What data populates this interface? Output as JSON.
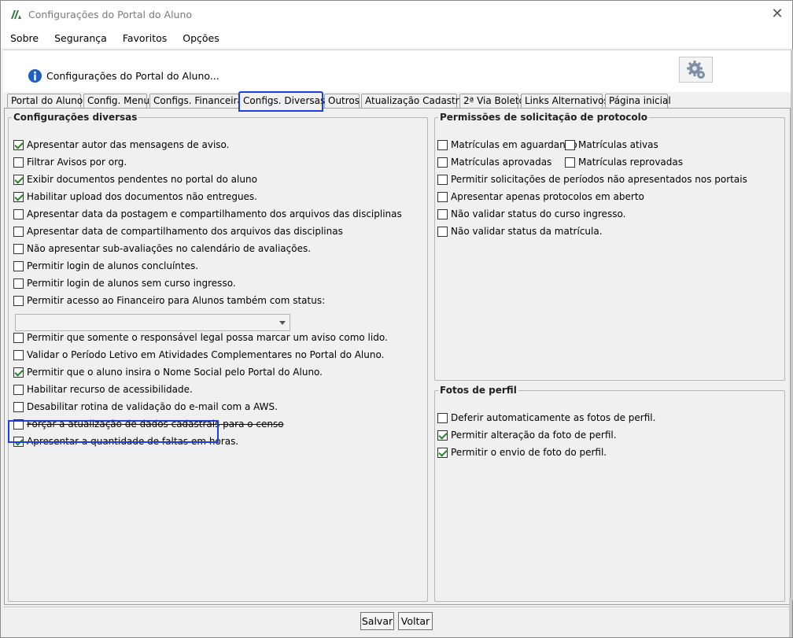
{
  "window": {
    "title": "Configurações do Portal do Aluno",
    "close_glyph": "✕"
  },
  "menu": {
    "items": [
      {
        "label": "Sobre"
      },
      {
        "label": "Segurança"
      },
      {
        "label": "Favoritos"
      },
      {
        "label": "Opções"
      }
    ]
  },
  "header": {
    "title": "Configurações do Portal do Aluno..."
  },
  "tabs": [
    {
      "label": "Portal do Aluno"
    },
    {
      "label": "Config. Menu"
    },
    {
      "label": "Configs. Financeiras"
    },
    {
      "label": "Configs. Diversas",
      "active": true
    },
    {
      "label": "Outros"
    },
    {
      "label": "Atualização Cadastral"
    },
    {
      "label": "2ª Via Boleto"
    },
    {
      "label": "Links Alternativos"
    },
    {
      "label": "Página inicial"
    }
  ],
  "diversas": {
    "legend": "Configurações diversas",
    "items": [
      {
        "label": "Apresentar autor das mensagens de aviso.",
        "checked": true
      },
      {
        "label": "Filtrar Avisos por org.",
        "checked": false
      },
      {
        "label": "Exibir documentos pendentes no portal do aluno",
        "checked": true
      },
      {
        "label": "Habilitar upload dos documentos não entregues.",
        "checked": true
      },
      {
        "label": "Apresentar data da postagem e compartilhamento dos arquivos das disciplinas",
        "checked": false
      },
      {
        "label": "Apresentar data de compartilhamento dos arquivos das disciplinas",
        "checked": false
      },
      {
        "label": "Não apresentar sub-avaliações no calendário de avaliações.",
        "checked": false
      },
      {
        "label": "Permitir login de alunos concluíntes.",
        "checked": false
      },
      {
        "label": "Permitir login de alunos sem curso ingresso.",
        "checked": false
      },
      {
        "label": "Permitir acesso ao Financeiro para Alunos também com status:",
        "checked": false
      },
      {
        "label": "Permitir que somente o responsável legal possa marcar um aviso como lido.",
        "checked": false
      },
      {
        "label": "Validar o Período Letivo em Atividades Complementares no Portal do Aluno.",
        "checked": false
      },
      {
        "label": "Permitir que o aluno insira o Nome Social pelo Portal do Aluno.",
        "checked": true
      },
      {
        "label": "Habilitar recurso de acessibilidade.",
        "checked": false
      },
      {
        "label": "Desabilitar rotina de validação do e-mail com a AWS.",
        "checked": false
      },
      {
        "label": "Forçar a atualização de dados cadastrais para o censo",
        "checked": false
      },
      {
        "label": "Apresentar a quantidade de faltas em horas.",
        "checked": true
      }
    ],
    "status_select_value": ""
  },
  "protocolo": {
    "legend": "Permissões de solicitação de protocolo",
    "items": [
      {
        "label": "Matrículas em aguardando",
        "checked": false
      },
      {
        "label": "Matrículas ativas",
        "checked": false
      },
      {
        "label": "Matrículas aprovadas",
        "checked": false
      },
      {
        "label": "Matrículas reprovadas",
        "checked": false
      },
      {
        "label": "Permitir solicitações de períodos não apresentados nos portais",
        "checked": false
      },
      {
        "label": "Apresentar apenas protocolos em aberto",
        "checked": false
      },
      {
        "label": "Não validar status do curso ingresso.",
        "checked": false
      },
      {
        "label": "Não validar status da matrícula.",
        "checked": false
      }
    ]
  },
  "fotos": {
    "legend": "Fotos de perfil",
    "items": [
      {
        "label": "Deferir automaticamente as fotos de perfil.",
        "checked": false
      },
      {
        "label": "Permitir alteração da foto de perfil.",
        "checked": true
      },
      {
        "label": "Permitir o envio de foto do perfil.",
        "checked": true
      }
    ]
  },
  "footer": {
    "save_label": "Salvar",
    "back_label": "Voltar"
  },
  "colors": {
    "highlight": "#1f3fd6",
    "check": "#1e8a1e"
  }
}
